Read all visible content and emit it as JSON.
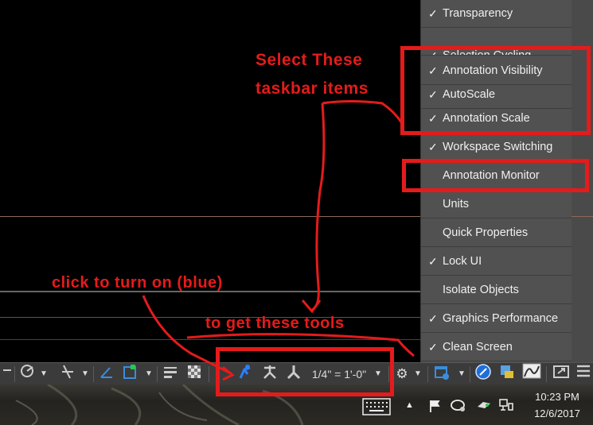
{
  "menu": {
    "items": [
      {
        "label": "Transparency",
        "checked": "✓"
      },
      {
        "label": "Selection Cycling",
        "checked": "✓"
      },
      {
        "label": "Annotation Visibility",
        "checked": "✓"
      },
      {
        "label": "AutoScale",
        "checked": "✓"
      },
      {
        "label": "Annotation Scale",
        "checked": "✓"
      },
      {
        "label": "Workspace Switching",
        "checked": "✓"
      },
      {
        "label": "Annotation Monitor",
        "checked": ""
      },
      {
        "label": "Units",
        "checked": ""
      },
      {
        "label": "Quick Properties",
        "checked": ""
      },
      {
        "label": "Lock UI",
        "checked": "✓"
      },
      {
        "label": "Isolate Objects",
        "checked": ""
      },
      {
        "label": "Graphics Performance",
        "checked": "✓"
      },
      {
        "label": "Clean Screen",
        "checked": "✓"
      }
    ]
  },
  "statusbar": {
    "scale_label": "1/4\" = 1'-0\"",
    "dropdown_arrow": "▼"
  },
  "annotations": {
    "select_line1": "Select These",
    "select_line2": "taskbar items",
    "click_text": "click to turn on (blue)",
    "tools_text": "to get these tools"
  },
  "taskbar": {
    "time": "10:23 PM",
    "date": "12/6/2017"
  },
  "colors": {
    "annotation_red": "#e51b1b",
    "menu_bg": "#515151",
    "active_blue": "#2a7fff"
  }
}
